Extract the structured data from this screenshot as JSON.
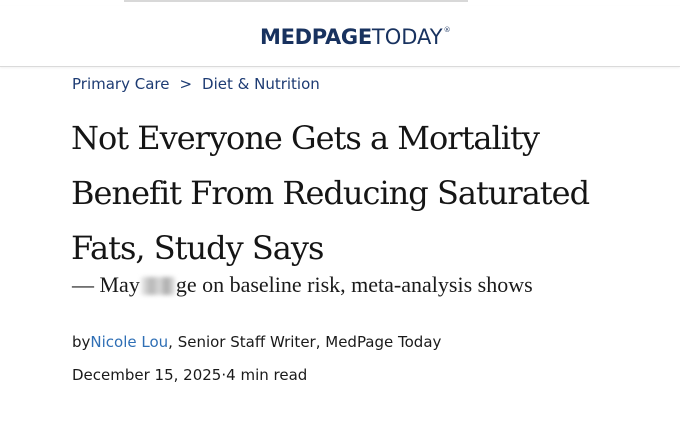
{
  "site": {
    "logo_bold": "MEDPAGE",
    "logo_light": "TODAY",
    "logo_reg": "®",
    "brand_color": "#18325f"
  },
  "breadcrumb": {
    "items": [
      "Primary Care",
      "Diet & Nutrition"
    ],
    "separator": ">"
  },
  "article": {
    "title": "Not Everyone Gets a Mortality Benefit From Reducing Saturated Fats, Study Says",
    "subtitle_prefix": "— May",
    "subtitle_suffix": "ge on baseline risk, meta-analysis shows",
    "byline_prefix": "by ",
    "author": "Nicole Lou",
    "byline_suffix": ", Senior Staff Writer, MedPage Today",
    "date": "December 15, 2025",
    "meta_sep": " · ",
    "read_time": "4 min read",
    "link_color": "#2f6fb5"
  }
}
